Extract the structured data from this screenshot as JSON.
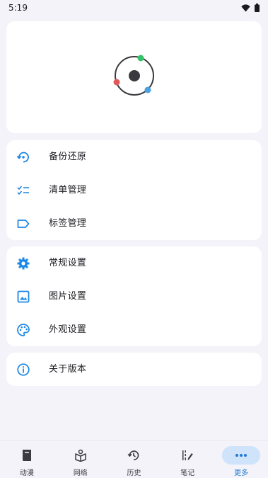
{
  "status_bar": {
    "time": "5:19"
  },
  "colors": {
    "accent": "#1e88e5",
    "nav_active_bg": "#cfe3fb",
    "logo_green": "#34c36a",
    "logo_red": "#e05a5a",
    "logo_blue": "#4aa3e0"
  },
  "menu": {
    "group1": [
      {
        "label": "备份还原",
        "icon": "backup-restore-icon"
      },
      {
        "label": "清单管理",
        "icon": "checklist-icon"
      },
      {
        "label": "标签管理",
        "icon": "tag-icon"
      }
    ],
    "group2": [
      {
        "label": "常规设置",
        "icon": "gear-icon"
      },
      {
        "label": "图片设置",
        "icon": "image-icon"
      },
      {
        "label": "外观设置",
        "icon": "palette-icon"
      }
    ],
    "group3": [
      {
        "label": "关于版本",
        "icon": "info-icon"
      }
    ]
  },
  "bottom_nav": {
    "items": [
      {
        "label": "动漫",
        "icon": "book-icon"
      },
      {
        "label": "网络",
        "icon": "network-book-icon"
      },
      {
        "label": "历史",
        "icon": "history-icon"
      },
      {
        "label": "笔记",
        "icon": "notes-icon"
      },
      {
        "label": "更多",
        "icon": "more-icon",
        "active": true
      }
    ]
  }
}
